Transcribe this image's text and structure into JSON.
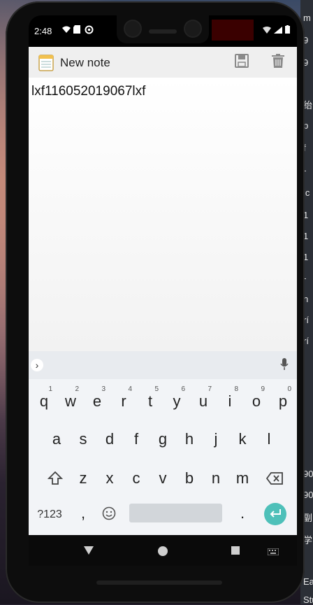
{
  "status": {
    "time": "2:48"
  },
  "app": {
    "title": "New note"
  },
  "note": {
    "text": "lxf116052019067lxf"
  },
  "keyboard": {
    "row1": [
      {
        "k": "q",
        "n": "1"
      },
      {
        "k": "w",
        "n": "2"
      },
      {
        "k": "e",
        "n": "3"
      },
      {
        "k": "r",
        "n": "4"
      },
      {
        "k": "t",
        "n": "5"
      },
      {
        "k": "y",
        "n": "6"
      },
      {
        "k": "u",
        "n": "7"
      },
      {
        "k": "i",
        "n": "8"
      },
      {
        "k": "o",
        "n": "9"
      },
      {
        "k": "p",
        "n": "0"
      }
    ],
    "row2": [
      "a",
      "s",
      "d",
      "f",
      "g",
      "h",
      "j",
      "k",
      "l"
    ],
    "row3": [
      "z",
      "x",
      "c",
      "v",
      "b",
      "n",
      "m"
    ],
    "symbols_label": "?123",
    "comma": ",",
    "period": "."
  },
  "right_edge_text": [
    "m",
    "9",
    "9",
    "绐",
    "p",
    "f",
    "-",
    "ic",
    "1",
    "1",
    "1",
    "-",
    "n",
    "rí",
    "rí",
    " 90",
    "90",
    "副",
    "学",
    "Ea",
    "Stu"
  ]
}
